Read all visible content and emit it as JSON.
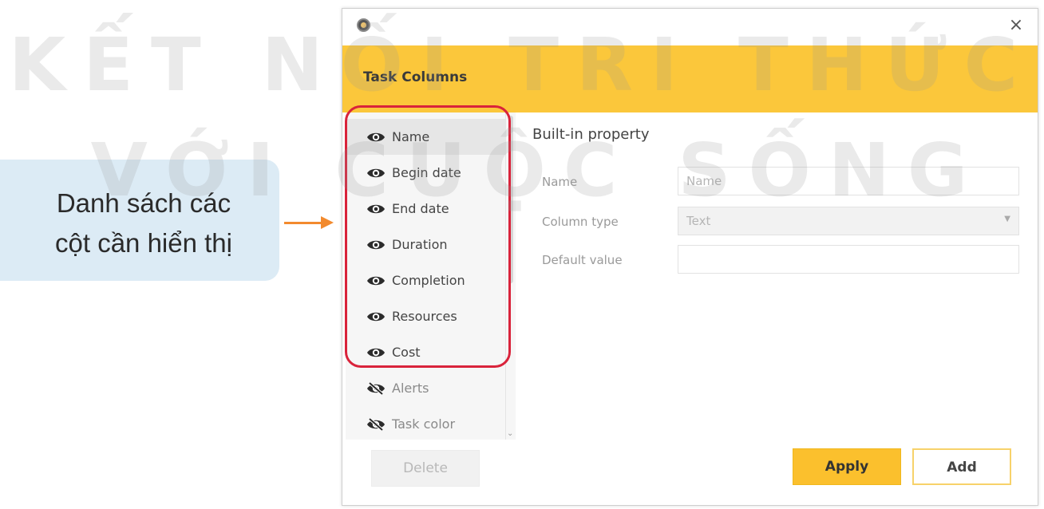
{
  "annotation": {
    "line1": "Danh sách các",
    "line2": "cột cần hiển thị",
    "highlight_color": "#d9233b",
    "arrow_color": "#f28a2e"
  },
  "watermark": {
    "line1": "KẾT NỐI TRI THỨC",
    "line2": "VỚI CUỘC SỐNG"
  },
  "dialog": {
    "title_icon": "app-icon",
    "close_label": "×",
    "header_title": "Task Columns",
    "header_color": "#fbc73b",
    "columns": [
      {
        "label": "Name",
        "visible": true,
        "selected": true
      },
      {
        "label": "Begin date",
        "visible": true,
        "selected": false
      },
      {
        "label": "End date",
        "visible": true,
        "selected": false
      },
      {
        "label": "Duration",
        "visible": true,
        "selected": false
      },
      {
        "label": "Completion",
        "visible": true,
        "selected": false
      },
      {
        "label": "Resources",
        "visible": true,
        "selected": false
      },
      {
        "label": "Cost",
        "visible": true,
        "selected": false
      },
      {
        "label": "Alerts",
        "visible": false,
        "selected": false
      },
      {
        "label": "Task color",
        "visible": false,
        "selected": false
      }
    ],
    "form": {
      "heading": "Built-in property",
      "name_label": "Name",
      "name_value": "Name",
      "type_label": "Column type",
      "type_value": "Text",
      "default_label": "Default value",
      "default_value": ""
    },
    "buttons": {
      "delete": "Delete",
      "apply": "Apply",
      "add": "Add"
    },
    "accent_color": "#fbc02d"
  }
}
